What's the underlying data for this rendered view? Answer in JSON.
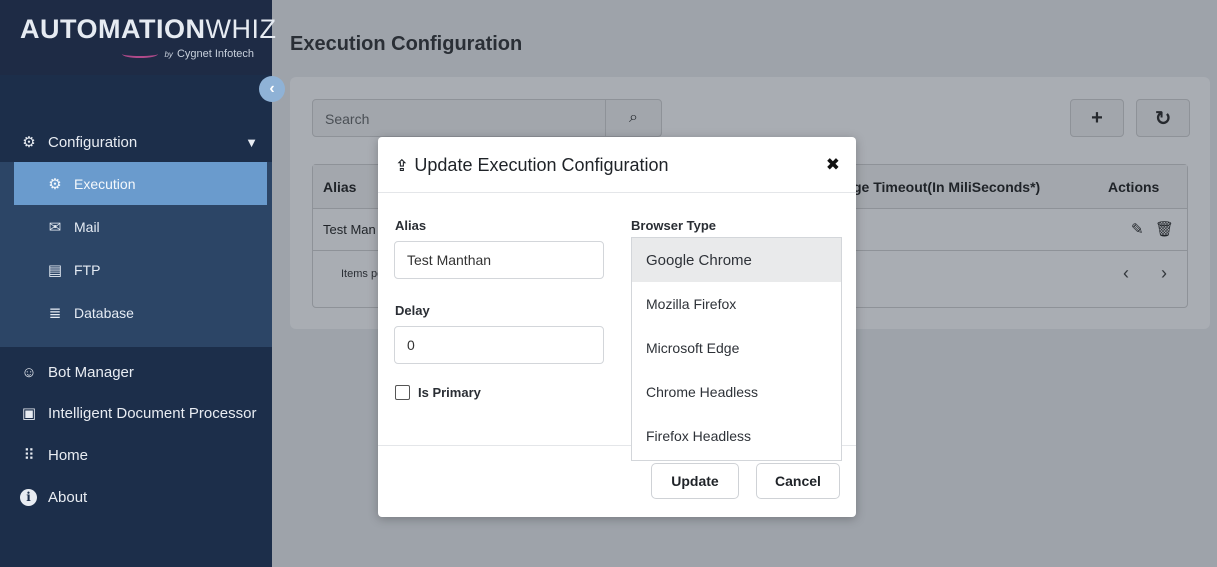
{
  "brand": {
    "name_bold": "AUTOMATION",
    "name_thin": "WHIZ",
    "by": "by",
    "sub": "Cygnet Infotech"
  },
  "sidebar": {
    "collapse_icon": "chevron-left-icon",
    "configuration": {
      "label": "Configuration",
      "icon": "gear-network-icon"
    },
    "sub_items": [
      {
        "label": "Execution",
        "icon": "gear-icon",
        "active": true
      },
      {
        "label": "Mail",
        "icon": "mail-icon"
      },
      {
        "label": "FTP",
        "icon": "ftp-icon"
      },
      {
        "label": "Database",
        "icon": "database-icon"
      }
    ],
    "items": [
      {
        "label": "Bot Manager",
        "icon": "users-icon"
      },
      {
        "label": "Intelligent Document Processor",
        "icon": "document-gear-icon"
      },
      {
        "label": "Home",
        "icon": "grid-icon"
      },
      {
        "label": "About",
        "icon": "info-icon"
      }
    ]
  },
  "page": {
    "title": "Execution Configuration",
    "search_placeholder": "Search",
    "add_label": "+",
    "refresh_label": "↻"
  },
  "table": {
    "headers": [
      "Alias",
      "ge Timeout(In MiliSeconds*)",
      "Actions"
    ],
    "rows": [
      {
        "alias": "Test Man"
      }
    ],
    "items_per_page": "Items pe"
  },
  "modal": {
    "title": "Update Execution Configuration",
    "alias_label": "Alias",
    "alias_value": "Test Manthan",
    "delay_label": "Delay",
    "delay_value": "0",
    "primary_label": "Is Primary",
    "browser_label": "Browser Type",
    "browser_options": [
      "Google Chrome",
      "Mozilla Firefox",
      "Microsoft Edge",
      "Chrome Headless",
      "Firefox Headless"
    ],
    "selected_browser": "Google Chrome",
    "update_label": "Update",
    "cancel_label": "Cancel"
  },
  "colors": {
    "sidebar": "#1c2e4a",
    "active_item": "#6a9bcd",
    "overlay": "#9ea3aa"
  }
}
